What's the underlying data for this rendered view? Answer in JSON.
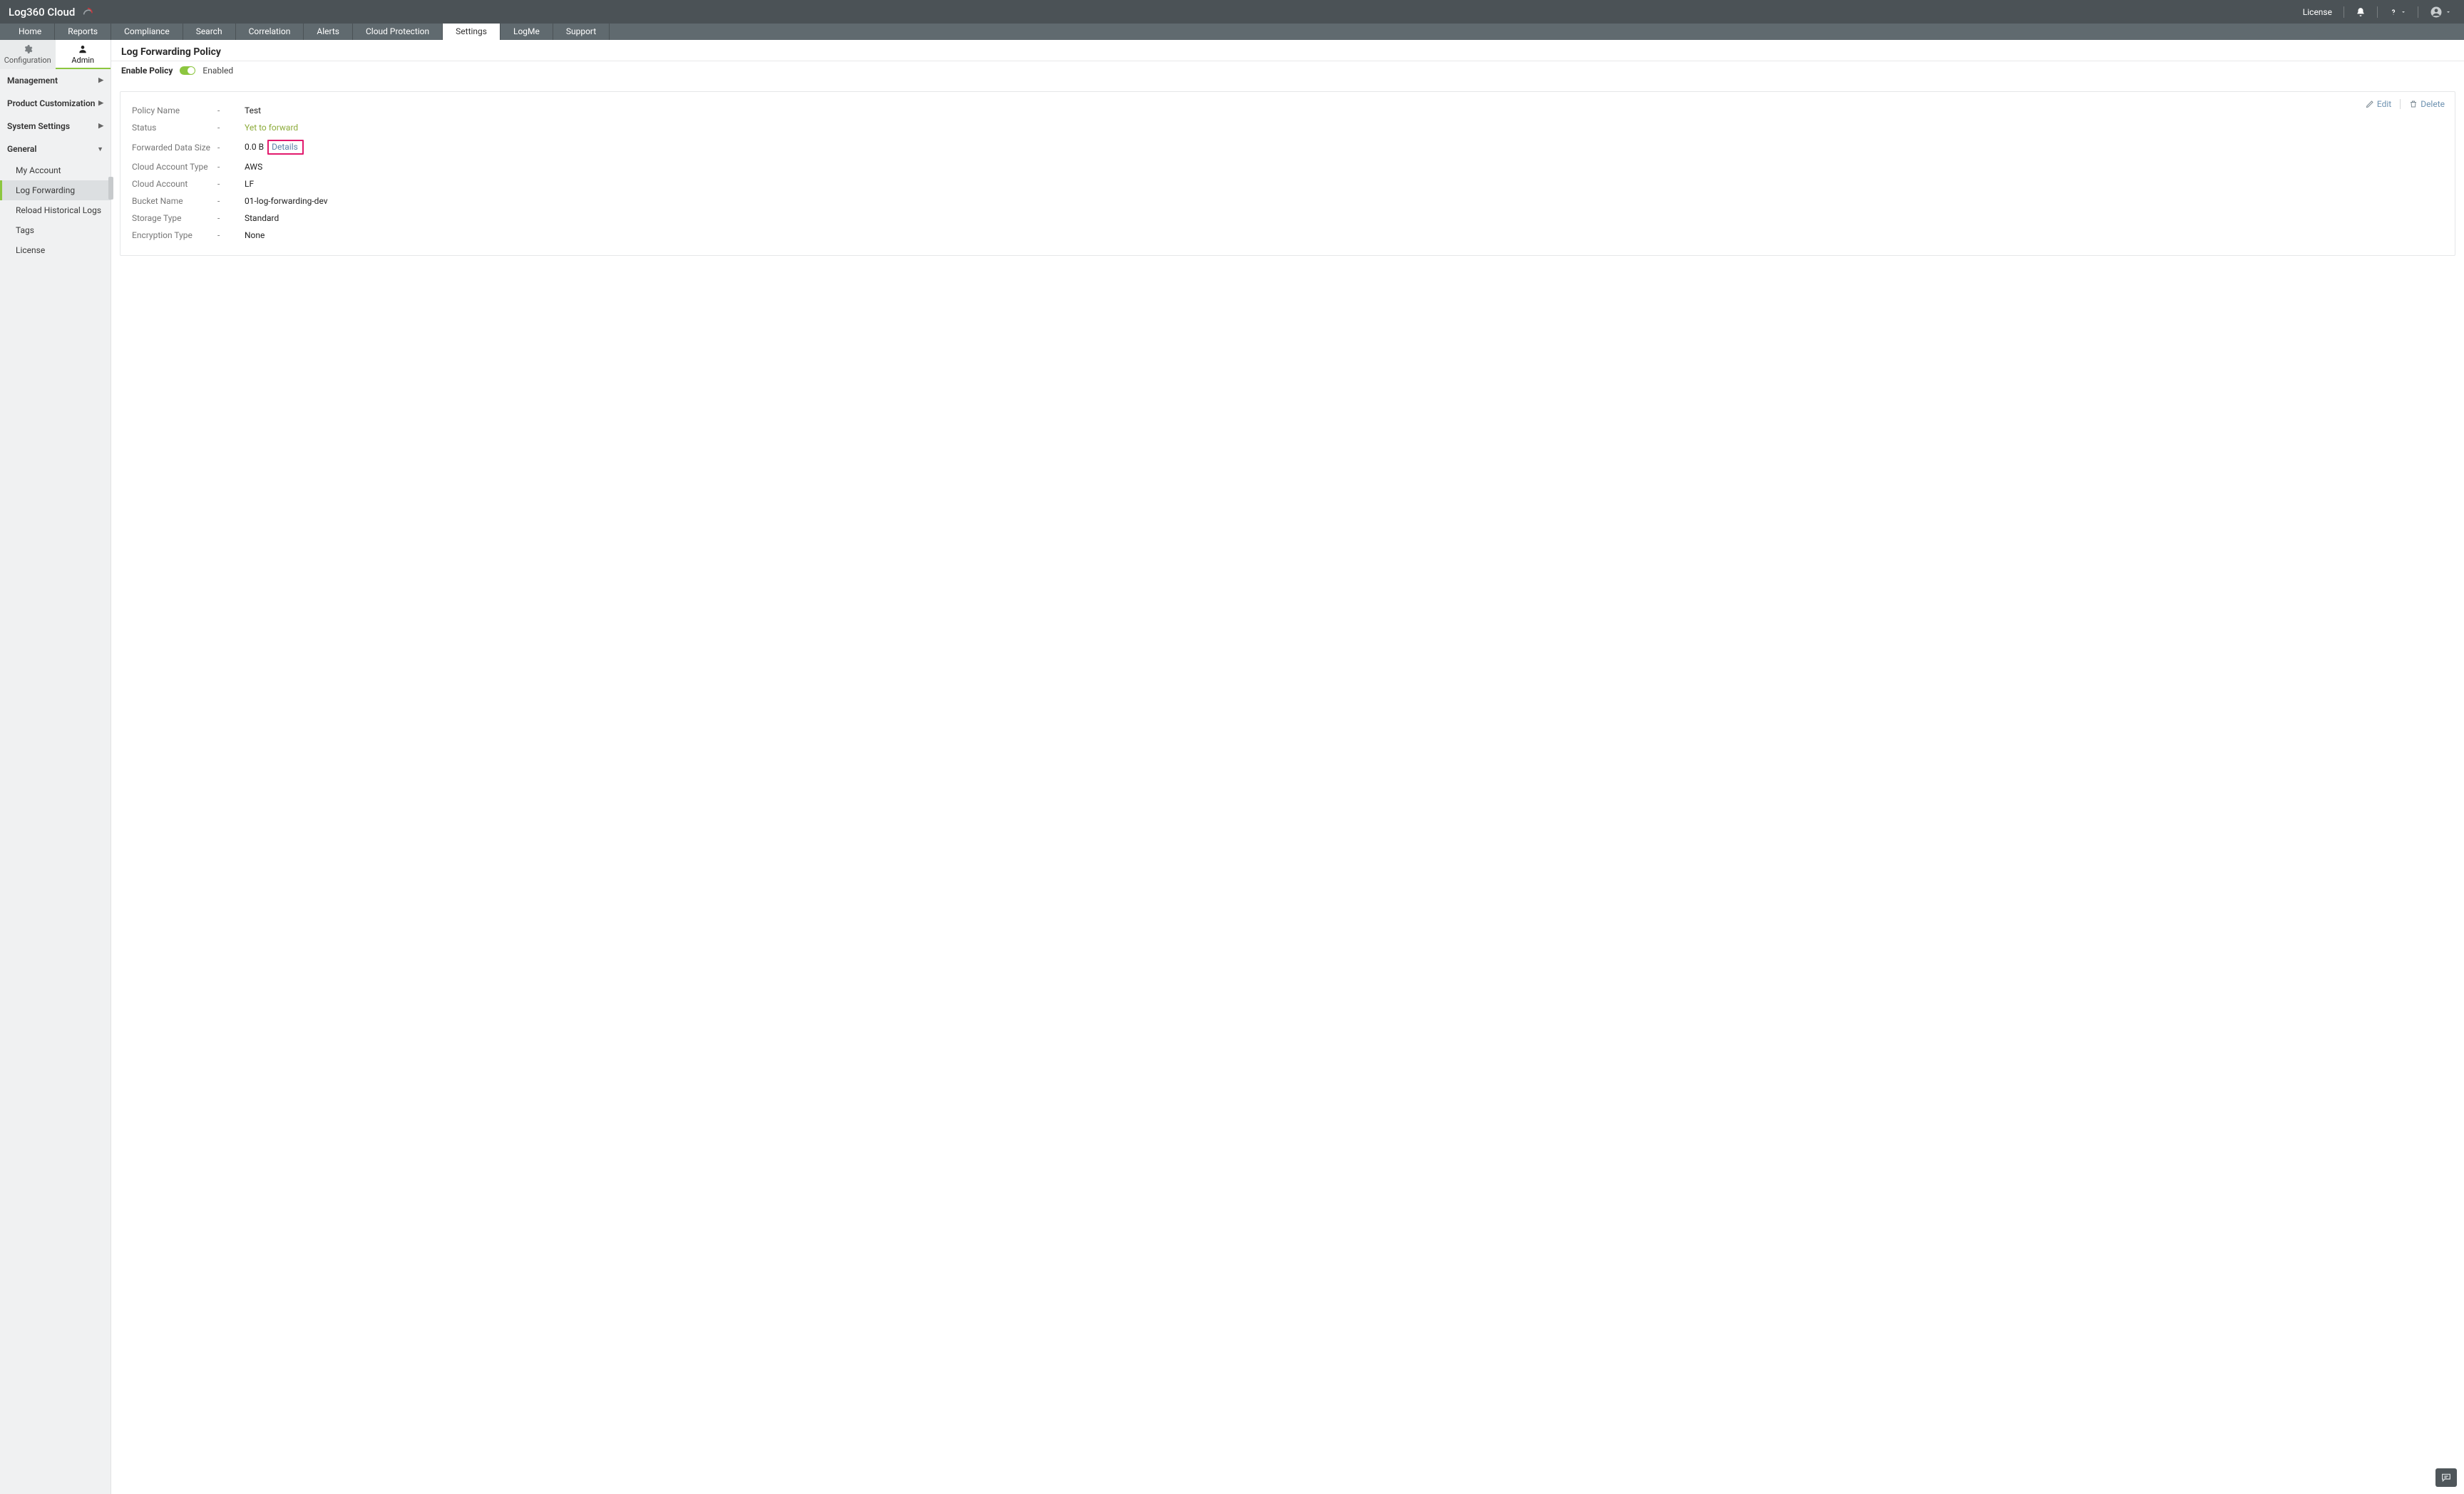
{
  "brand": {
    "name": "Log360 Cloud"
  },
  "topbar": {
    "license": "License"
  },
  "mainnav": [
    "Home",
    "Reports",
    "Compliance",
    "Search",
    "Correlation",
    "Alerts",
    "Cloud Protection",
    "Settings",
    "LogMe",
    "Support"
  ],
  "mainnav_active": "Settings",
  "subtabs": {
    "configuration": "Configuration",
    "admin": "Admin"
  },
  "sidebar": {
    "sections": [
      {
        "label": "Management",
        "expanded": false
      },
      {
        "label": "Product Customization",
        "expanded": false
      },
      {
        "label": "System Settings",
        "expanded": false
      },
      {
        "label": "General",
        "expanded": true,
        "items": [
          "My Account",
          "Log Forwarding",
          "Reload Historical Logs",
          "Tags",
          "License"
        ],
        "active_item": "Log Forwarding"
      }
    ]
  },
  "page": {
    "title": "Log Forwarding Policy",
    "enable_label": "Enable Policy",
    "enable_state": "Enabled"
  },
  "actions": {
    "edit": "Edit",
    "delete": "Delete"
  },
  "policy": {
    "labels": {
      "policy_name": "Policy Name",
      "status": "Status",
      "forwarded_data_size": "Forwarded Data Size",
      "cloud_account_type": "Cloud Account Type",
      "cloud_account": "Cloud Account",
      "bucket_name": "Bucket Name",
      "storage_type": "Storage Type",
      "encryption_type": "Encryption Type"
    },
    "dash": "-",
    "values": {
      "policy_name": "Test",
      "status": "Yet to forward",
      "forwarded_data_size": "0.0 B",
      "details_text": "Details",
      "cloud_account_type": "AWS",
      "cloud_account": "LF",
      "bucket_name": "01-log-forwarding-dev",
      "storage_type": "Standard",
      "encryption_type": "None"
    }
  }
}
